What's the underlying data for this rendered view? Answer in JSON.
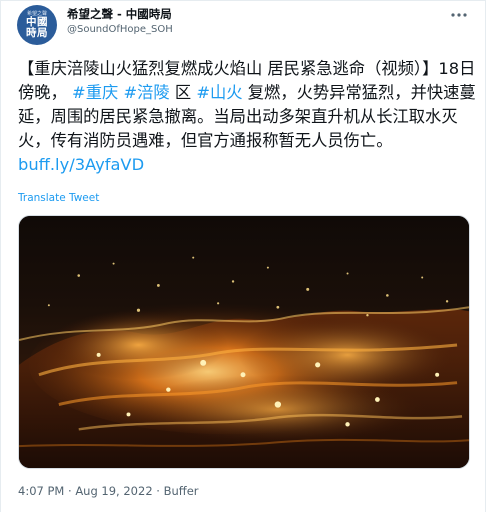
{
  "author": {
    "avatar_top_text": "希望之聲",
    "avatar_line1": "中國",
    "avatar_line2": "時局",
    "display_name": "希望之聲 - 中國時局",
    "handle": "@SoundOfHope_SOH"
  },
  "tweet": {
    "text_part1": "【重庆涪陵山火猛烈复燃成火焰山 居民紧急逃命（视频）】18日傍晚，",
    "hashtag1": "#重庆",
    "hashtag2": "#涪陵",
    "text_part2": "区",
    "hashtag3": "#山火",
    "text_part3": "复燃，火势异常猛烈，并快速蔓延，周围的居民紧急撤离。当局出动多架直升机从长江取水灭火，传有消防员遇难，但官方通报称暂无人员伤亡。",
    "link": "buff.ly/3AyfaVD",
    "translate_label": "Translate Tweet"
  },
  "meta": {
    "time": "4:07 PM",
    "separator": " · ",
    "date": "Aug 19, 2022",
    "source": "Buffer"
  },
  "colors": {
    "link": "#1d9bf0",
    "text": "#0f1419",
    "secondary": "#536471",
    "avatar_bg": "#2b5c9a"
  },
  "icons": {
    "more": "more-horizontal-icon"
  }
}
